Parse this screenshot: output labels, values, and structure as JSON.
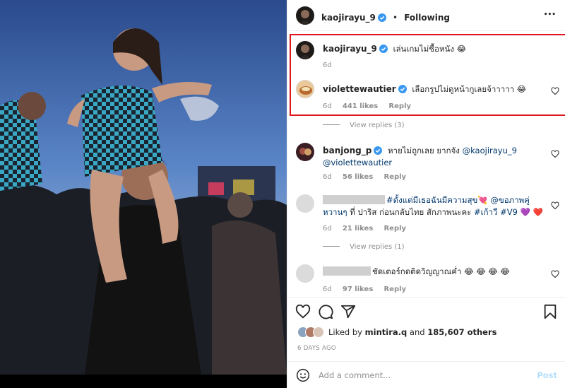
{
  "header": {
    "username": "kaojirayu_9",
    "separator": "•",
    "following": "Following",
    "more": "•••"
  },
  "comments": [
    {
      "username": "kaojirayu_9",
      "text": "เล่นเกมไม่ซื้อหนัง 😂",
      "time": "6d"
    },
    {
      "username": "violettewautier",
      "text": "เลือกรูปไม่ดูหน้ากูเลยจ้าาาาา 😂",
      "time": "6d",
      "likes": "441 likes",
      "reply": "Reply"
    },
    {
      "view_replies": "View replies (3)"
    },
    {
      "username": "banjong_p",
      "text": "หายไม่ถูกเลย ยากจัง ",
      "mention1": "@kaojirayu_9",
      "mention2": "@violettewautier",
      "time": "6d",
      "likes": "56 likes",
      "reply": "Reply"
    },
    {
      "hashtag": "#ตั้งแต่มีเธอฉันมีความสุข",
      "emoji": "💘",
      "mention": "@ขอภาพคู่หวานๆ",
      "text2": " ที่ ปาริส ก่อนกลับไทย สักภาพนะคะ ",
      "hashtag2": "#เก้าวี",
      "hashtag3": "#V9",
      "hearts": "💜 ❤️",
      "time": "6d",
      "likes": "21 likes",
      "reply": "Reply"
    },
    {
      "view_replies": "View replies (1)"
    },
    {
      "text": "ชัดเตอร์กดติดวิญญาณค่ำ 😂 😂 😂 😂",
      "time": "6d",
      "likes": "97 likes",
      "reply": "Reply"
    }
  ],
  "likes": {
    "prefix": "Liked by ",
    "user": "mintira.q",
    "and": " and ",
    "others": "185,607 others"
  },
  "date": "6 DAYS AGO",
  "add_comment": {
    "placeholder": "Add a comment...",
    "post": "Post"
  },
  "colors": {
    "highlight": "#e0161e",
    "verified": "#3897f0",
    "link": "#00376b",
    "post_disabled": "#b2dffc"
  },
  "icons": [
    "heart-icon",
    "comment-icon",
    "share-icon",
    "bookmark-icon",
    "emoji-icon",
    "verified-badge-icon",
    "more-icon"
  ]
}
